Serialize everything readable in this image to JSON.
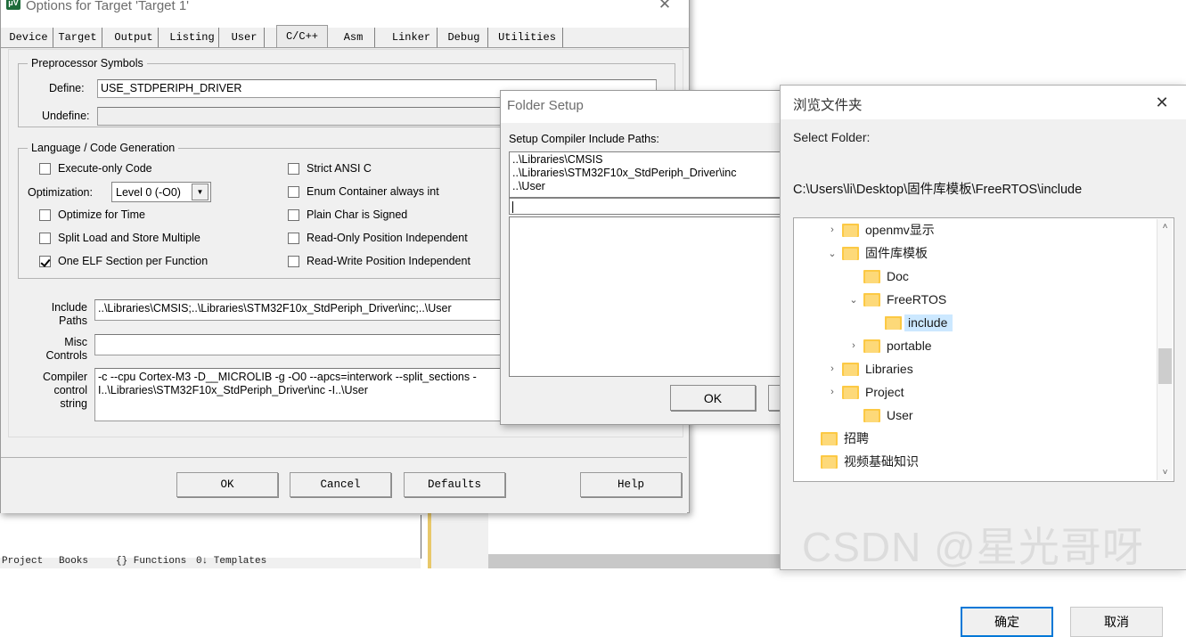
{
  "options_dialog": {
    "title": "Options for Target 'Target 1'",
    "icon": "keil-uvision-icon",
    "close_label": "✕",
    "tabs": [
      {
        "label": "Device",
        "active": false
      },
      {
        "label": "Target",
        "active": false
      },
      {
        "label": "Output",
        "active": false
      },
      {
        "label": "Listing",
        "active": false
      },
      {
        "label": "User",
        "active": false
      },
      {
        "label": "C/C++",
        "active": true
      },
      {
        "label": "Asm",
        "active": false
      },
      {
        "label": "Linker",
        "active": false
      },
      {
        "label": "Debug",
        "active": false
      },
      {
        "label": "Utilities",
        "active": false
      }
    ],
    "preprocessor": {
      "group_label": "Preprocessor Symbols",
      "define_label": "Define:",
      "define_value": "USE_STDPERIPH_DRIVER",
      "undefine_label": "Undefine:",
      "undefine_value": ""
    },
    "language": {
      "group_label": "Language / Code Generation",
      "left_checks": [
        {
          "label": "Execute-only Code",
          "checked": false
        },
        {
          "label": "Optimize for Time",
          "checked": false
        },
        {
          "label": "Split Load and Store Multiple",
          "checked": false
        },
        {
          "label": "One ELF Section per Function",
          "checked": true
        }
      ],
      "right_checks": [
        {
          "label": "Strict ANSI C",
          "checked": false
        },
        {
          "label": "Enum Container always int",
          "checked": false
        },
        {
          "label": "Plain Char is Signed",
          "checked": false
        },
        {
          "label": "Read-Only Position Independent",
          "checked": false
        },
        {
          "label": "Read-Write Position Independent",
          "checked": false
        }
      ],
      "optimization_label": "Optimization:",
      "optimization_value": "Level 0 (-O0)"
    },
    "fields": {
      "include_paths_label_line1": "Include",
      "include_paths_label_line2": "Paths",
      "include_paths_value": "..\\Libraries\\CMSIS;..\\Libraries\\STM32F10x_StdPeriph_Driver\\inc;..\\User",
      "misc_label_line1": "Misc",
      "misc_label_line2": "Controls",
      "misc_value": "",
      "compiler_label_line1": "Compiler",
      "compiler_label_line2": "control",
      "compiler_label_line3": "string",
      "compiler_value": "-c --cpu Cortex-M3 -D__MICROLIB -g -O0 --apcs=interwork --split_sections -I..\\Libraries\\STM32F10x_StdPeriph_Driver\\inc -I..\\User"
    },
    "buttons": [
      {
        "label": "OK"
      },
      {
        "label": "Cancel"
      },
      {
        "label": "Defaults"
      },
      {
        "label": "Help"
      }
    ]
  },
  "folder_setup": {
    "title": "Folder Setup",
    "list_label": "Setup Compiler Include Paths:",
    "paths": [
      "..\\Libraries\\CMSIS",
      "..\\Libraries\\STM32F10x_StdPeriph_Driver\\inc",
      "..\\User"
    ],
    "edit_value": "",
    "ok_label": "OK"
  },
  "browse_dialog": {
    "title": "浏览文件夹",
    "close_label": "✕",
    "select_label": "Select Folder:",
    "path": "C:\\Users\\li\\Desktop\\固件库模板\\FreeRTOS\\include",
    "tree": [
      {
        "label": "openmv显示",
        "indent": 1,
        "chevron": "collapsed",
        "selected": false
      },
      {
        "label": "固件库模板",
        "indent": 1,
        "chevron": "expanded",
        "selected": false
      },
      {
        "label": "Doc",
        "indent": 2,
        "chevron": "none",
        "selected": false
      },
      {
        "label": "FreeRTOS",
        "indent": 2,
        "chevron": "expanded",
        "selected": false
      },
      {
        "label": "include",
        "indent": 3,
        "chevron": "none",
        "selected": true
      },
      {
        "label": "portable",
        "indent": 3,
        "chevron": "collapsed",
        "selected": false
      },
      {
        "label": "Libraries",
        "indent": 2,
        "chevron": "collapsed",
        "selected": false
      },
      {
        "label": "Project",
        "indent": 2,
        "chevron": "collapsed",
        "selected": false
      },
      {
        "label": "User",
        "indent": 2,
        "chevron": "none",
        "selected": false
      },
      {
        "label": "招聘",
        "indent": 1,
        "chevron": "none",
        "selected": false
      },
      {
        "label": "视频基础知识",
        "indent": 1,
        "chevron": "none",
        "selected": false
      }
    ],
    "scrollbar": {
      "up_arrow": "˄",
      "down_arrow": "˅"
    },
    "ok_label": "确定",
    "cancel_label": "取消",
    "accent_color": "#0078d7",
    "selection_color": "#cce8ff"
  },
  "watermark": {
    "text": "CSDN @星光哥呀"
  },
  "background": {
    "project_tab": "Project",
    "books_tab": "Books",
    "funcs_tab": "{} Functions",
    "templates_tab": "0↓ Templates"
  }
}
